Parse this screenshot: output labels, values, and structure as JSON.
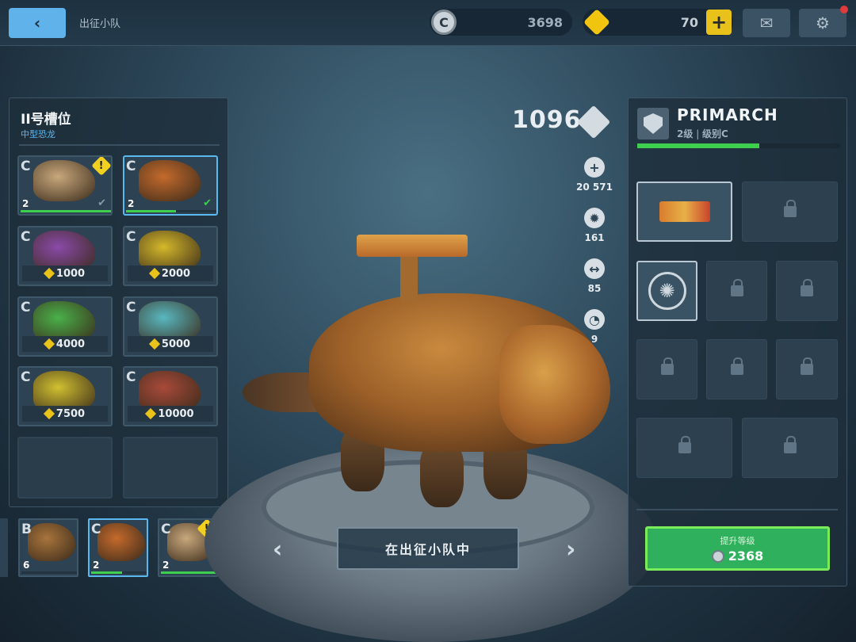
{
  "topbar": {
    "breadcrumb": "出征小队",
    "coins": "3698",
    "gems": "70"
  },
  "slot": {
    "title": "II号槽位",
    "subtitle": "中型恐龙"
  },
  "roster": [
    {
      "rank": "C",
      "level": "2",
      "price": null,
      "warning": true,
      "selected": false,
      "xp": 1.0,
      "color": "#c8a87c"
    },
    {
      "rank": "C",
      "level": "2",
      "price": null,
      "warning": false,
      "selected": true,
      "xp": 0.55,
      "color": "#c46a2c"
    },
    {
      "rank": "C",
      "level": null,
      "price": "1000",
      "color": "#8a4aa8"
    },
    {
      "rank": "C",
      "level": null,
      "price": "2000",
      "color": "#d4b82a"
    },
    {
      "rank": "C",
      "level": null,
      "price": "4000",
      "color": "#4ab04a"
    },
    {
      "rank": "C",
      "level": null,
      "price": "5000",
      "color": "#58b8c0"
    },
    {
      "rank": "C",
      "level": null,
      "price": "7500",
      "color": "#d0c030"
    },
    {
      "rank": "C",
      "level": null,
      "price": "10000",
      "color": "#a84a3a"
    }
  ],
  "squad": [
    {
      "rank": "B",
      "level": "6",
      "xp": 0.0,
      "color": "#a8743c"
    },
    {
      "rank": "C",
      "level": "2",
      "xp": 0.55,
      "color": "#c46a2c"
    },
    {
      "rank": "C",
      "level": "2",
      "xp": 1.0,
      "color": "#c8a87c",
      "warning": true
    }
  ],
  "center": {
    "power": "1096",
    "stats": [
      {
        "icon": "health-icon",
        "glyph": "+",
        "value": "20 571"
      },
      {
        "icon": "damage-icon",
        "glyph": "✹",
        "value": "161"
      },
      {
        "icon": "range-icon",
        "glyph": "↔",
        "value": "85"
      },
      {
        "icon": "speed-icon",
        "glyph": "◔",
        "value": "9"
      }
    ],
    "squad_status": "在出征小队中"
  },
  "right": {
    "name": "PRIMARCH",
    "level_text": "2级",
    "rank_text": "级别C",
    "progress": 0.6,
    "upgrade_label": "提升等级",
    "upgrade_cost": "2368"
  }
}
